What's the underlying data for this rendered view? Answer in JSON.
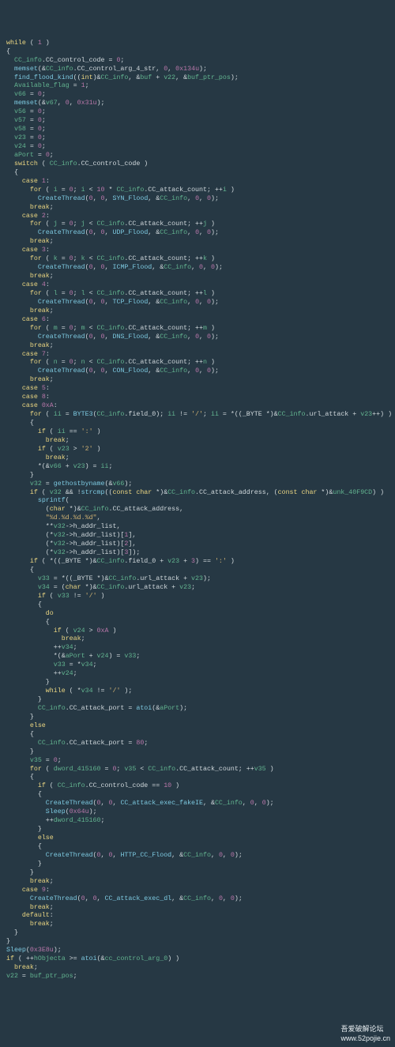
{
  "watermark": {
    "left": "吾爱破解论坛",
    "url": "www.52pojie.cn"
  },
  "code": {
    "struct_name": "CC_info",
    "fields": {
      "code": "CC_control_code",
      "arg4": "CC_control_arg_4_str",
      "count": "CC_attack_count",
      "addr": "CC_attack_address",
      "port": "CC_attack_port",
      "url": "url_attack",
      "f0": "field_0"
    },
    "funcs": {
      "memset": "memset",
      "find": "find_flood_kind",
      "create": "CreateThread",
      "sleep": "Sleep",
      "atoi": "atoi",
      "ghbn": "gethostbyname",
      "strcmp": "strcmp",
      "sprintf": "sprintf",
      "byte3": "BYTE3"
    },
    "vars": {
      "avail": "Available_flag",
      "v66": "v66",
      "v67": "v67",
      "v56": "v56",
      "v57": "v57",
      "v58": "v58",
      "v23": "v23",
      "v24": "v24",
      "aPort": "aPort",
      "i": "i",
      "j": "j",
      "k": "k",
      "l": "l",
      "m": "m",
      "n": "n",
      "ii": "ii",
      "v32": "v32",
      "v33": "v33",
      "v34": "v34",
      "v35": "v35",
      "buf": "buf",
      "v22": "v22",
      "bufpos": "buf_ptr_pos",
      "dw415160": "dword_415160",
      "unk": "unk_40F9CD",
      "hObjecta": "hObjecta",
      "ccarg0": "cc_control_arg_0"
    },
    "threads": {
      "syn": "SYN_Flood",
      "udp": "UDP_Flood",
      "icmp": "ICMP_Flood",
      "tcp": "TCP_Flood",
      "dns": "DNS_Flood",
      "con": "CON_Flood",
      "fakeie": "CC_attack_exec_fakeIE",
      "httpcc": "HTTP_CC_Flood",
      "dl": "CC_attack_exec_dl"
    },
    "nums": {
      "zero": "0",
      "one": "1",
      "ten10": "10",
      "hex134u": "0x134u",
      "hex31u": "0x31u",
      "caseA": "0xA",
      "three": "3",
      "eq10": "10",
      "sleep64": "0x64u",
      "port80": "80",
      "sleep3e8": "0x3E8u"
    },
    "strs": {
      "colon": "':'",
      "two": "'2'",
      "slash": "'/'",
      "semi": "';'",
      "fmt": "\"%d.%d.%d.%d\""
    },
    "members": {
      "hal": "h_addr_list"
    }
  }
}
